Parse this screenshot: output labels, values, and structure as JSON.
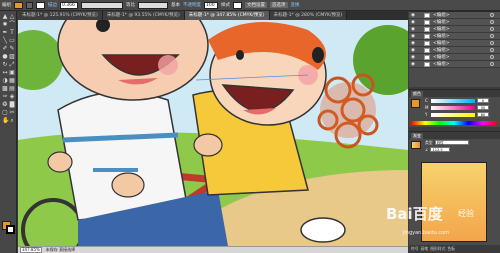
{
  "control_bar": {
    "selection_label": "编组",
    "stroke_label": "描边",
    "stroke_value": "0.366",
    "profile_label": "等比",
    "brush_label": "基本",
    "opacity_label": "不透明度",
    "opacity_value": "100",
    "style_label": "样式",
    "doc_setup_label": "文档设置",
    "prefs_label": "首选项",
    "transform_label": "变换",
    "fill_color": "#e8962a"
  },
  "tabs": [
    {
      "label": "未标题-1* @ 125.91% (CMYK/预览)"
    },
    {
      "label": "未标题-1* @ 93.55% (CMYK/预览)"
    },
    {
      "label": "未标题-1* @ 347.85% (CMYK/预览)"
    },
    {
      "label": "未标题-1* @ 280% (CMYK/预览)"
    }
  ],
  "status_bar": {
    "zoom": "347.85%",
    "state": "未保存 直接选择"
  },
  "layers": [
    {
      "name": "<编组>"
    },
    {
      "name": "<编组>"
    },
    {
      "name": "<编组>"
    },
    {
      "name": "<编组>"
    },
    {
      "name": "<编组>"
    },
    {
      "name": "<编组>"
    },
    {
      "name": "<编组>"
    },
    {
      "name": "<编组>"
    }
  ],
  "color_panel": {
    "channels": [
      {
        "label": "C",
        "value": "0"
      },
      {
        "label": "M",
        "value": "50"
      },
      {
        "label": "Y",
        "value": "80"
      },
      {
        "label": "K",
        "value": "0"
      }
    ],
    "header": "颜色"
  },
  "gradient_panel": {
    "header": "渐变",
    "type_label": "类型",
    "type_value": "线性",
    "angle_value": "112.5"
  },
  "panel_bottom_tabs": [
    "符号",
    "画笔",
    "图形样式",
    "色板"
  ],
  "watermark": {
    "brand": "Bai百度",
    "sub": "经验",
    "url": "jingyan.baidu.com"
  }
}
